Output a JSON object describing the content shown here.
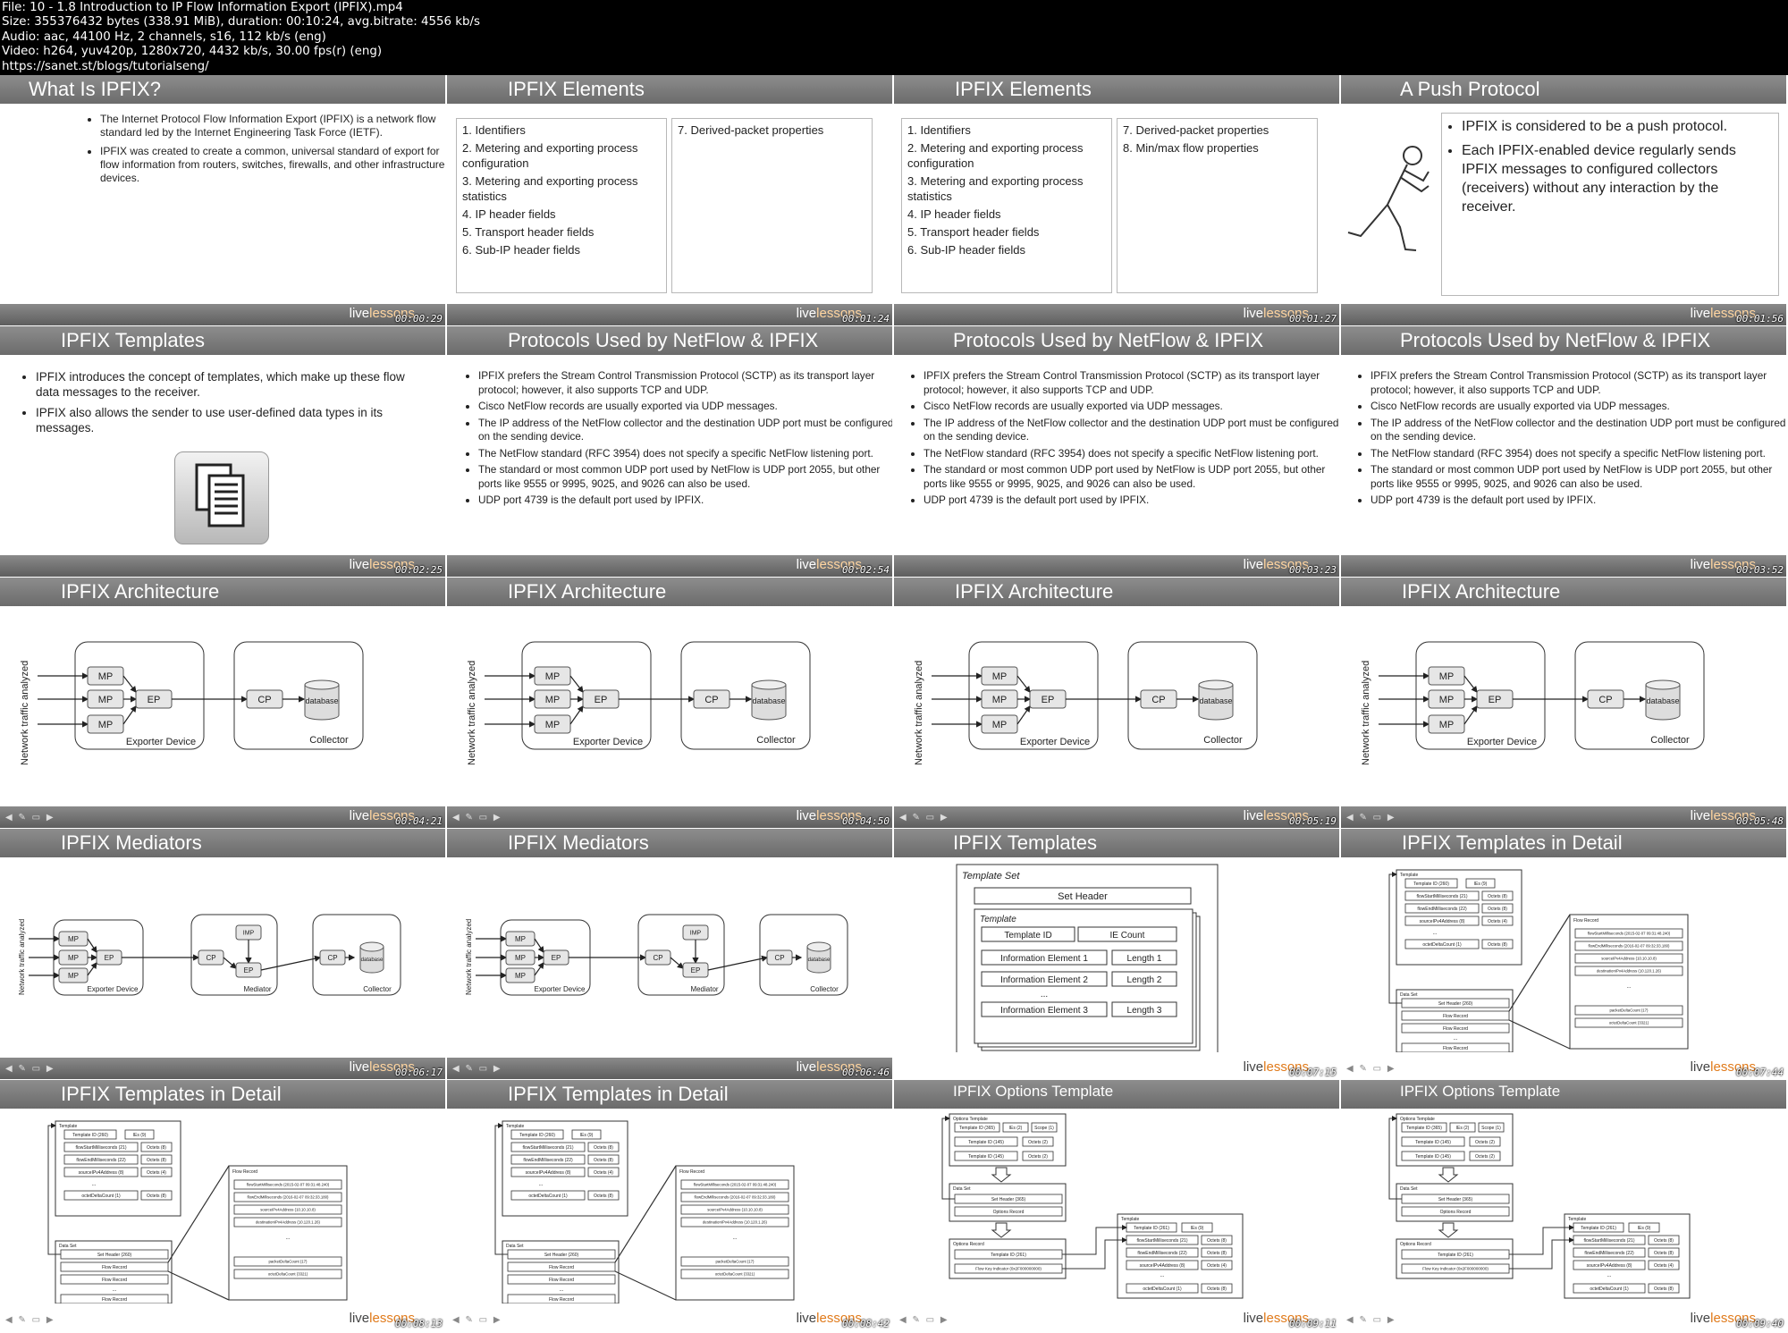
{
  "header": {
    "file": "File: 10 - 1.8 Introduction to IP Flow Information Export (IPFIX).mp4",
    "size": "Size: 355376432 bytes (338.91 MiB), duration: 00:10:24, avg.bitrate: 4556 kb/s",
    "audio": "Audio: aac, 44100 Hz, 2 channels, s16, 112 kb/s (eng)",
    "video": "Video: h264, yuv420p, 1280x720, 4432 kb/s, 30.00 fps(r) (eng)",
    "url": "https://sanet.st/blogs/tutorialseng/"
  },
  "brand": {
    "live": "live",
    "lessons": "lessons"
  },
  "titles": {
    "what_is": "What Is IPFIX?",
    "elements": "IPFIX Elements",
    "push": "A Push Protocol",
    "templates": "IPFIX Templates",
    "protocols": "Protocols Used by NetFlow & IPFIX",
    "architecture": "IPFIX Architecture",
    "mediators": "IPFIX Mediators",
    "templates_detail": "IPFIX Templates in Detail",
    "options": "IPFIX Options Template"
  },
  "timestamps": [
    "00:00:29",
    "00:01:24",
    "00:01:27",
    "00:01:56",
    "00:02:25",
    "00:02:54",
    "00:03:23",
    "00:03:52",
    "00:04:21",
    "00:04:50",
    "00:05:19",
    "00:05:48",
    "00:06:17",
    "00:06:46",
    "00:07:15",
    "00:07:44",
    "00:08:13",
    "00:08:42",
    "00:09:11",
    "00:09:40"
  ],
  "what_is": {
    "b1": "The Internet Protocol Flow Information Export (IPFIX) is a network flow standard led by the Internet Engineering Task Force (IETF).",
    "b2": "IPFIX was created to create a common, universal standard of export for flow information from routers, switches, firewalls, and other infrastructure devices."
  },
  "elements": {
    "e1": "1. Identifiers",
    "e2": "2. Metering and exporting process configuration",
    "e3": "3. Metering and exporting process statistics",
    "e4": "4. IP header fields",
    "e5": "5. Transport header fields",
    "e6": "6. Sub-IP header fields",
    "e7": "7. Derived-packet properties",
    "e8": "8. Min/max flow properties"
  },
  "push": {
    "b1": "IPFIX is considered to be a push protocol.",
    "b2": "Each IPFIX-enabled device regularly sends IPFIX messages to configured collectors (receivers) without any interaction by the receiver."
  },
  "templates": {
    "b1": "IPFIX introduces the concept of templates, which make up these flow data messages to the receiver.",
    "b2": "IPFIX also allows the sender to use user-defined data types in its messages."
  },
  "protocols": {
    "b1": "IPFIX prefers the Stream Control Transmission Protocol (SCTP) as its transport layer protocol; however, it also supports TCP and UDP.",
    "b2": "Cisco NetFlow records are usually exported via UDP messages.",
    "b3": "The IP address of the NetFlow collector and the destination UDP port must be configured on the sending device.",
    "b4": "The NetFlow standard (RFC 3954) does not specify a specific NetFlow listening port.",
    "b5": "The standard or most common UDP port used by NetFlow is UDP port 2055, but other ports like 9555 or 9995, 9025, and 9026 can also be used.",
    "b6": "UDP port 4739 is the default port used by IPFIX."
  },
  "arch": {
    "side": "Network traffic analyzed",
    "mp": "MP",
    "ep": "EP",
    "cp": "CP",
    "imp": "IMP",
    "database": "database",
    "exporter": "Exporter Device",
    "collector": "Collector",
    "mediator": "Mediator"
  },
  "tset": {
    "set_title": "Template Set",
    "set_header": "Set Header",
    "template": "Template",
    "tid": "Template ID",
    "iec": "IE Count",
    "ie1": "Information Element 1",
    "ie2": "Information Element 2",
    "ie3": "Information Element 3",
    "l1": "Length 1",
    "l2": "Length 2",
    "l3": "Length 3",
    "dots": "..."
  },
  "detail": {
    "template": "Template",
    "tid": "Template ID (260)",
    "ies": "IEs (9)",
    "f1": "flowStartMilliseconds (21)",
    "f2": "flowEndMilliseconds (22)",
    "f3": "sourceIPv4Address (8)",
    "f4": "octetDeltaCount (1)",
    "o8": "Octets (8)",
    "o4": "Octets (4)",
    "dots": "...",
    "dataset": "Data Set",
    "sethdr": "Set Header (260)",
    "flowrec": "Flow Record",
    "r1": "flowStartMilliseconds (2015-02-07 09:31:48.240)",
    "r2": "flowEndMilliseconds (2016-02-07 09:32:33.180)",
    "r3": "sourceIPv4Address (10.10.10.8)",
    "r4": "destinationIPv4Address (10.120.1.26)",
    "r5": "packetDeltaCount (17)",
    "r6": "octetDeltaCount (3321)"
  },
  "options": {
    "otpl": "Options Template",
    "tid": "Template ID (365)",
    "ies": "IEs (2)",
    "scope": "Scope (1)",
    "t1": "Template ID (145)",
    "o2": "Octets (2)",
    "dataset": "Data Set",
    "sethdr": "Set Header (365)",
    "orec": "Options Record",
    "orec2": "Options Record",
    "tid261": "Template ID (261)",
    "flowkey": "Flow Key Indicator (0x2F000000000)",
    "template": "Template",
    "tid2": "Template ID (261)",
    "ies2": "IEs (9)",
    "f1": "flowStartMilliseconds (21)",
    "f2": "flowEndMilliseconds (22)",
    "f3": "sourceIPv4Address (8)",
    "f4": "octetDeltaCount (1)",
    "o8": "Octets (8)",
    "o4": "Octets (4)",
    "dots": "..."
  }
}
